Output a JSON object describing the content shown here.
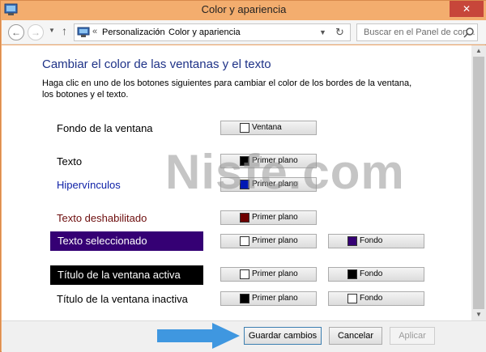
{
  "window": {
    "title": "Color y apariencia",
    "close_label": "✕"
  },
  "nav": {
    "crumb_sep": "«",
    "crumbs": [
      "Personalización",
      "Color y apariencia"
    ],
    "arrow": "›",
    "search_placeholder": "Buscar en el Panel de con..."
  },
  "page": {
    "heading": "Cambiar el color de las ventanas y el texto",
    "description": "Haga clic en uno de los botones siguientes para cambiar el color de los bordes de la ventana, los botones y el texto."
  },
  "items": [
    {
      "label": "Fondo de la ventana",
      "buttons": [
        {
          "label": "Ventana",
          "swatch": "#ffffff"
        }
      ]
    },
    {
      "label": "Texto",
      "buttons": [
        {
          "label": "Primer plano",
          "swatch": "#000000"
        }
      ]
    },
    {
      "label": "Hipervínculos",
      "color": "#0b1ea6",
      "buttons": [
        {
          "label": "Primer plano",
          "swatch": "#0018b4"
        }
      ]
    },
    {
      "label": "Texto deshabilitado",
      "color": "#6d0d0d",
      "buttons": [
        {
          "label": "Primer plano",
          "swatch": "#6d0000"
        }
      ]
    },
    {
      "label": "Texto seleccionado",
      "bg": "#350074",
      "color": "#ffffff",
      "buttons": [
        {
          "label": "Primer plano",
          "swatch": "#ffffff"
        },
        {
          "label": "Fondo",
          "swatch": "#350074"
        }
      ]
    },
    {
      "label": "Título de la ventana activa",
      "bg": "#000000",
      "color": "#ffffff",
      "buttons": [
        {
          "label": "Primer plano",
          "swatch": "#ffffff"
        },
        {
          "label": "Fondo",
          "swatch": "#000000"
        }
      ]
    },
    {
      "label": "Título de la ventana inactiva",
      "buttons": [
        {
          "label": "Primer plano",
          "swatch": "#000000"
        },
        {
          "label": "Fondo",
          "swatch": "#ffffff"
        }
      ]
    }
  ],
  "footer": {
    "save": "Guardar cambios",
    "cancel": "Cancelar",
    "apply": "Aplicar"
  },
  "watermark": "Nisfe.com",
  "colors": {
    "accent_arrow": "#3f97e0",
    "titlebar": "#f3ad6e",
    "close": "#c7463a"
  }
}
